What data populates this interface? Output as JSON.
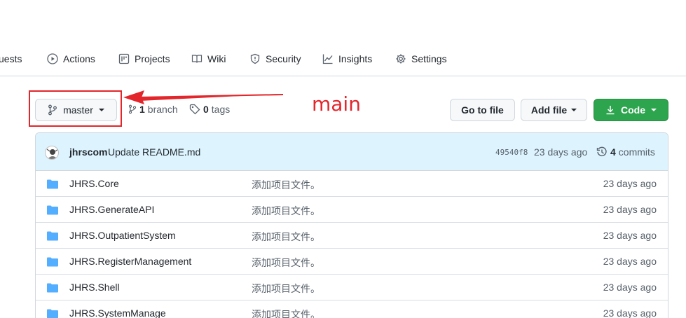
{
  "repo_nav": {
    "items": [
      {
        "label": "uests",
        "icon": "pull-request-icon"
      },
      {
        "label": "Actions",
        "icon": "play-icon"
      },
      {
        "label": "Projects",
        "icon": "project-icon"
      },
      {
        "label": "Wiki",
        "icon": "book-icon"
      },
      {
        "label": "Security",
        "icon": "shield-icon"
      },
      {
        "label": "Insights",
        "icon": "graph-icon"
      },
      {
        "label": "Settings",
        "icon": "gear-icon"
      }
    ]
  },
  "toolbar": {
    "branch_label": "master",
    "branch_count": "1",
    "branch_word": "branch",
    "tag_count": "0",
    "tag_word": "tags",
    "go_to_file": "Go to file",
    "add_file": "Add file",
    "code": "Code"
  },
  "annotation": {
    "text": "main",
    "color": "#e3262b"
  },
  "commit": {
    "author": "jhrscom",
    "message": "Update README.md",
    "sha": "49540f8",
    "age": "23 days ago",
    "count": "4",
    "count_word": "commits"
  },
  "files": [
    {
      "name": "JHRS.Core",
      "message": "添加项目文件。",
      "age": "23 days ago"
    },
    {
      "name": "JHRS.GenerateAPI",
      "message": "添加项目文件。",
      "age": "23 days ago"
    },
    {
      "name": "JHRS.OutpatientSystem",
      "message": "添加项目文件。",
      "age": "23 days ago"
    },
    {
      "name": "JHRS.RegisterManagement",
      "message": "添加项目文件。",
      "age": "23 days ago"
    },
    {
      "name": "JHRS.Shell",
      "message": "添加项目文件。",
      "age": "23 days ago"
    },
    {
      "name": "JHRS.SystemManage",
      "message": "添加项目文件。",
      "age": "23 days ago"
    }
  ],
  "colors": {
    "code_button": "#2da44e",
    "folder_icon": "#54aeff",
    "commit_bar": "#ddf4ff"
  }
}
